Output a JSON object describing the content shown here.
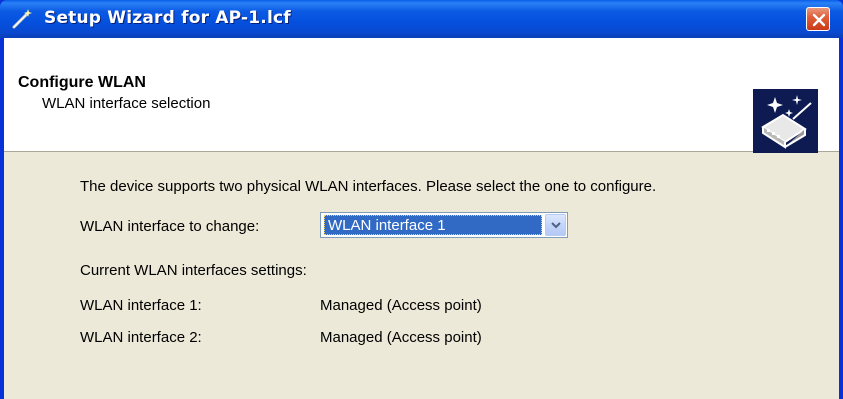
{
  "window": {
    "title": "Setup Wizard for AP-1.lcf"
  },
  "header": {
    "title": "Configure WLAN",
    "subtitle": "WLAN interface selection",
    "logo_icon": "wizard-device-sparkle-icon"
  },
  "main": {
    "intro": "The device supports two physical WLAN interfaces. Please select the one to configure.",
    "change_label": "WLAN interface to change:",
    "change_value": "WLAN interface 1",
    "current_label": "Current WLAN interfaces settings:",
    "interfaces": [
      {
        "name": "WLAN interface 1:",
        "mode": "Managed (Access point)"
      },
      {
        "name": "WLAN interface 2:",
        "mode": "Managed (Access point)"
      }
    ]
  },
  "colors": {
    "titlebar": "#0450dd",
    "selection": "#316ac5",
    "dialog_bg": "#ece9d8",
    "close_button": "#e0603a"
  }
}
